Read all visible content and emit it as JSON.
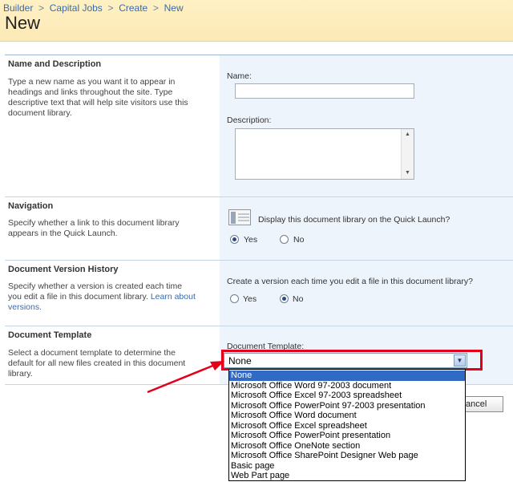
{
  "breadcrumb": {
    "items": [
      "Builder",
      "Capital Jobs",
      "Create",
      "New"
    ],
    "separator": ">"
  },
  "page": {
    "title": "New"
  },
  "sections": {
    "name_description": {
      "title": "Name and Description",
      "description": "Type a new name as you want it to appear in headings and links throughout the site. Type descriptive text that will help site visitors use this document library.",
      "name_label": "Name:",
      "name_value": "",
      "description_label": "Description:",
      "description_value": ""
    },
    "navigation": {
      "title": "Navigation",
      "description": "Specify whether a link to this document library appears in the Quick Launch.",
      "question": "Display this document library on the Quick Launch?",
      "yes_label": "Yes",
      "no_label": "No",
      "selected": "yes"
    },
    "version_history": {
      "title": "Document Version History",
      "description_prefix": "Specify whether a version is created each time you edit a file in this document library.",
      "learn_more": "Learn about versions.",
      "question": "Create a version each time you edit a file in this document library?",
      "yes_label": "Yes",
      "no_label": "No",
      "selected": "no"
    },
    "template": {
      "title": "Document Template",
      "description": "Select a document template to determine the default for all new files created in this document library.",
      "label": "Document Template:",
      "selected_value": "None",
      "options": [
        "None",
        "Microsoft Office Word 97-2003 document",
        "Microsoft Office Excel 97-2003 spreadsheet",
        "Microsoft Office PowerPoint 97-2003 presentation",
        "Microsoft Office Word document",
        "Microsoft Office Excel spreadsheet",
        "Microsoft Office PowerPoint presentation",
        "Microsoft Office OneNote section",
        "Microsoft Office SharePoint Designer Web page",
        "Basic page",
        "Web Part page"
      ]
    }
  },
  "buttons": {
    "cancel_partial": "ancel"
  },
  "colors": {
    "header_bg": "#fff1c4",
    "right_panel_bg": "#eef4fc",
    "link": "#3b6aa6",
    "selection": "#316ac5",
    "annotation_red": "#e2001a"
  },
  "icons": {
    "quick_launch": "quick-launch-icon",
    "dropdown_arrow": "chevron-down-icon",
    "annotation_arrow": "arrow-icon"
  }
}
